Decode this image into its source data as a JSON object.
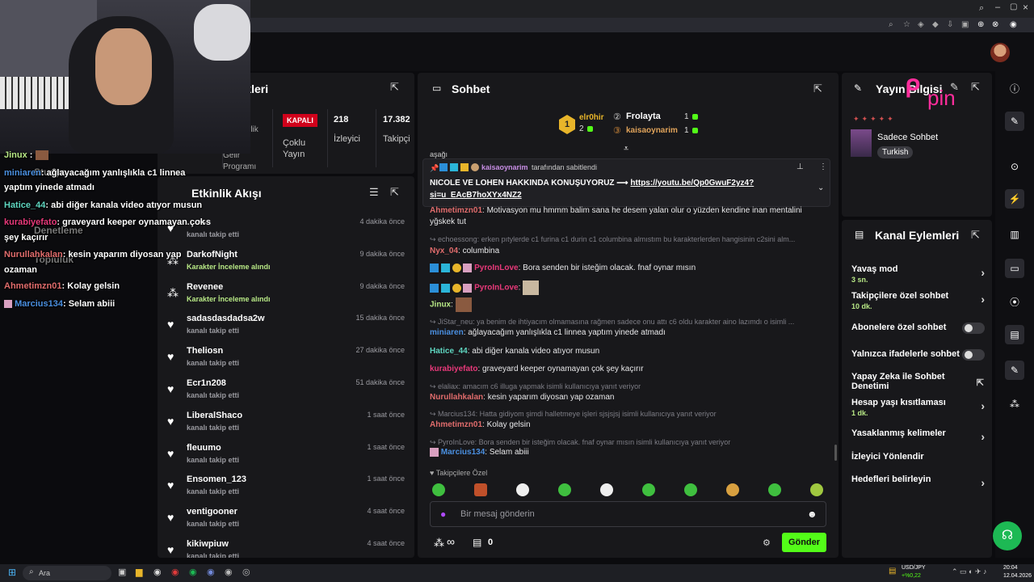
{
  "stats": {
    "title_partial": "stikleri",
    "closed_badge": "KAPALI",
    "multi_stream": "Çoklu Yayın",
    "viewers_count": "218",
    "viewers_label": "İzleyici",
    "followers_count": "17.382",
    "followers_label": "Takipçi",
    "upcoming_partial": "Gelir Programı",
    "other_partial": "rlik"
  },
  "activity": {
    "title": "Etkinlik Akışı",
    "items": [
      {
        "name": "…oss",
        "sub": "kanalı takip etti",
        "time": "4 dakika önce",
        "green": false
      },
      {
        "name": "DarkofNight",
        "sub": "Karakter İnceleme alındı",
        "time": "9 dakika önce",
        "green": true
      },
      {
        "name": "Revenee",
        "sub": "Karakter İnceleme alındı",
        "time": "9 dakika önce",
        "green": true
      },
      {
        "name": "sadasdasdadsa2w",
        "sub": "kanalı takip etti",
        "time": "15 dakika önce",
        "green": false
      },
      {
        "name": "Theliosn",
        "sub": "kanalı takip etti",
        "time": "27 dakika önce",
        "green": false
      },
      {
        "name": "Ecr1n208",
        "sub": "kanalı takip etti",
        "time": "51 dakika önce",
        "green": false
      },
      {
        "name": "LiberalShaco",
        "sub": "kanalı takip etti",
        "time": "1 saat önce",
        "green": false
      },
      {
        "name": "fleuumo",
        "sub": "kanalı takip etti",
        "time": "1 saat önce",
        "green": false
      },
      {
        "name": "Ensomen_123",
        "sub": "kanalı takip etti",
        "time": "1 saat önce",
        "green": false
      },
      {
        "name": "ventigooner",
        "sub": "kanalı takip etti",
        "time": "4 saat önce",
        "green": false
      },
      {
        "name": "kikiwpiuw",
        "sub": "kanalı takip etti",
        "time": "4 saat önce",
        "green": false
      }
    ]
  },
  "chat": {
    "title": "Sohbet",
    "top1_name": "elr0hir",
    "top1_count": "2",
    "top2_name": "Frolayta",
    "top2_count": "1",
    "top3_name": "kaisaoynarim",
    "top3_count": "1",
    "cut_text": "aşağı",
    "pinned_by": "kaisaoynarim",
    "pinned_suffix": "tarafından sabitlendi",
    "pinned_msg": "NICOLE VE LOHEN HAKKINDA KONUŞUYORUZ ⟶ ",
    "pinned_link": "https://youtu.be/Qp0GwuF2yz4?si=u_EAcB7hoXYx4NZ2",
    "m1_name": "Ahmetimzn01",
    "m1_text": "Motivasyon mu hmmm balim sana he desem yalan olur o yüzden kendine inan mentalini yğskek tut",
    "r2": "echoessong: erken pıtylerde c1 furina c1 durin c1 columbina almıstım bu karakterlerden hangisinin c2sini alm...",
    "m2_name": "Nyx_04",
    "m2_text": "columbina",
    "m3_name": "PyroInLove",
    "m3_text": "Bora senden bir isteğim olacak. fnaf oynar mısın",
    "m4_name": "PyroInLove",
    "m5_name": "Jinux",
    "r6": "JiStar_neu: ya benim de ihtiyacım olmamasına rağmen sadece onu attı c6 oldu karakter aino lazımdı o isimli ...",
    "m6_name": "miniaren",
    "m6_text": "ağlayacağım yanlışlıkla c1 linnea yaptım yinede atmadı",
    "m7_name": "Hatice_44",
    "m7_text": "abi diğer kanala video atıyor musun",
    "m8_name": "kurabiyefato",
    "m8_text": "graveyard keeper oynamayan çok şey kaçırır",
    "r9": "elaliax: amacım c6 illuga yapmak isimli kullanıcıya yanıt veriyor",
    "m9_name": "Nurullahkalan",
    "m9_text": "kesin yaparım diyosan yap ozaman",
    "r10": "Marcius134: Hatta gidiyom şimdi halletmeye işleri sjsjsjsj isimli kullanıcıya yanıt veriyor",
    "m10_name": "Ahmetimzn01",
    "m10_text": "Kolay gelsin",
    "r11": "PyroInLove: Bora senden bir isteğim olacak. fnaf oynar mısın isimli kullanıcıya yanıt veriyor",
    "m11_name": "Marcius134",
    "m11_text": "Selam abiii",
    "followers_only": "Takipçilere Özel",
    "input_placeholder": "Bir mesaj gönderin",
    "infinity": "∞",
    "count": "0",
    "send": "Gönder"
  },
  "info": {
    "title": "Yayın Bilgisi",
    "category": "Sadece Sohbet",
    "lang": "Turkish"
  },
  "actions": {
    "title": "Kanal Eylemleri",
    "slow": "Yavaş mod",
    "slow_sub": "3 sn.",
    "followers": "Takipçilere özel sohbet",
    "followers_sub": "10 dk.",
    "subs": "Abonelere özel sohbet",
    "emote": "Yalnızca ifadelerle sohbet",
    "ai": "Yapay Zeka ile Sohbet Denetimi",
    "age": "Hesap yaşı kısıtlaması",
    "age_sub": "1 dk.",
    "banned": "Yasaklanmış kelimeler",
    "raid": "İzleyici Yönlendir",
    "goals": "Hedefleri belirleyin"
  },
  "overlay": {
    "l1_name": "Jinux",
    "l2_name": "miniaren",
    "l2_text": ": ağlayacağım yanlışlıkla c1 linnea",
    "l2b": "yaptım yinede atmadı",
    "l3_name": "Hatice_44",
    "l3_text": ": abi diğer kanala video atıyor musun",
    "l4_name": "kurabiyefato",
    "l4_text": ": graveyard keeper oynamayan çok",
    "l4b": "şey kaçırır",
    "l5_name": "Nurullahkalan",
    "l5_text": ": kesin yaparım diyosan yap",
    "l5b": "ozaman",
    "l6_name": "Ahmetimzn01",
    "l6_text": ": Kolay gelsin",
    "l7_name": "Marcius134",
    "l7_text": ": Selam abiii",
    "bg1": "Studyo",
    "bg2": "Denetleme",
    "bg3": "Topluluk"
  },
  "taskbar": {
    "search": "Ara",
    "pair": "USD/JPY",
    "pair_change": "+%0,22",
    "time": "20:04",
    "date": "12.04.2026"
  },
  "colors": {
    "accent": "#53fc18",
    "pinned_bg": "#202024",
    "panel": "#18181b"
  }
}
